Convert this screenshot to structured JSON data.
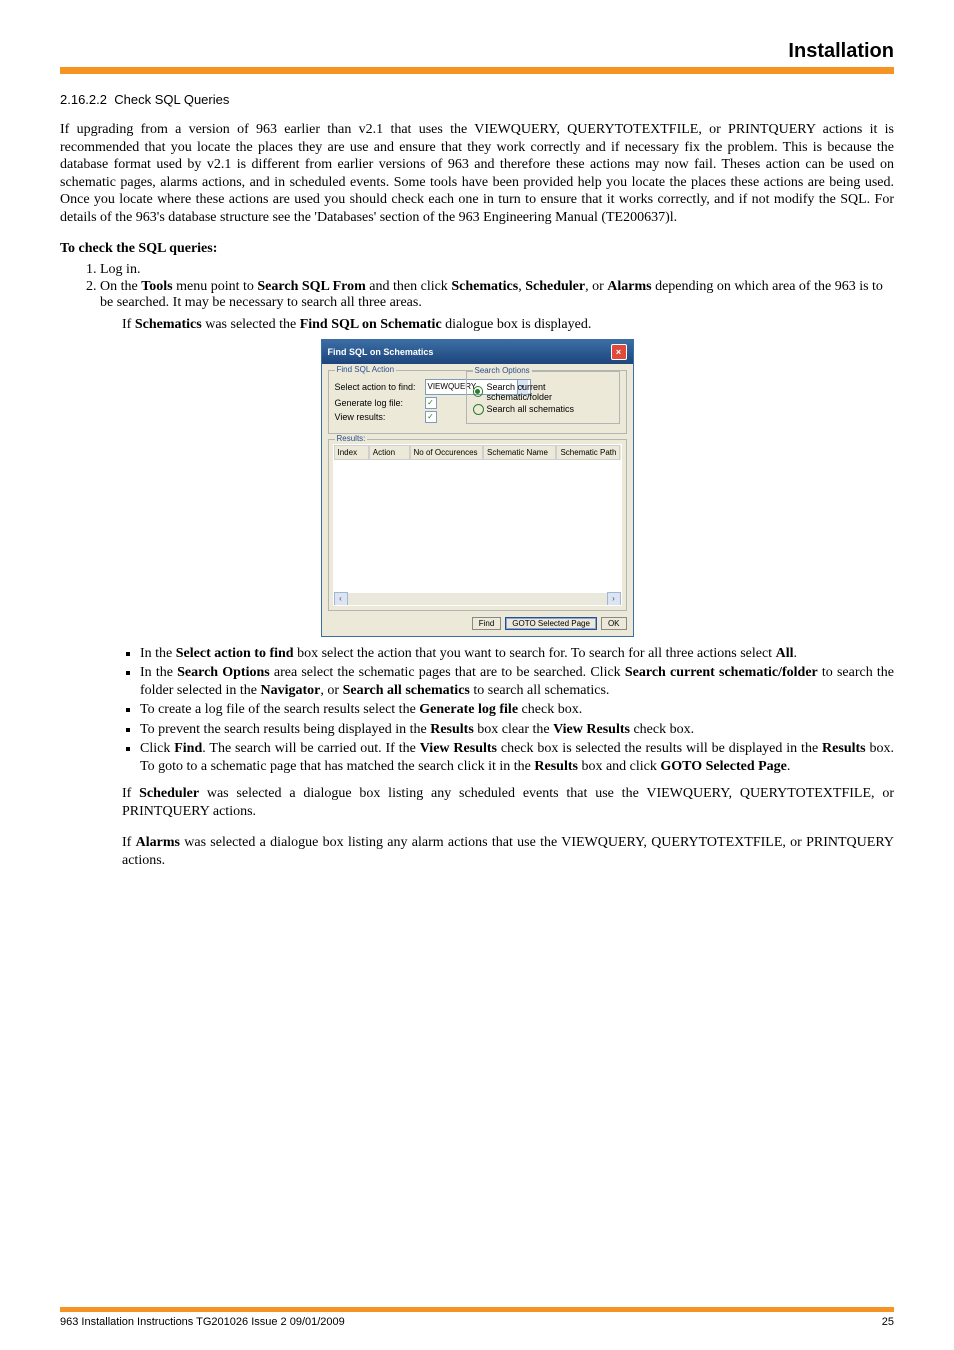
{
  "header": {
    "title": "Installation"
  },
  "section": {
    "number": "2.16.2.2",
    "title": "Check SQL Queries"
  },
  "para1": "If upgrading from a version of 963 earlier than v2.1 that uses the VIEWQUERY, QUERYTOTEXTFILE, or PRINTQUERY actions it is recommended that you locate the places they are use and ensure that they work correctly and if necessary fix the problem. This is because the database format used by v2.1 is different from earlier versions of 963 and therefore these actions may now fail. Theses action can be used on schematic pages, alarms actions, and in scheduled events. Some tools have been provided help you locate the places these actions are being used. Once you locate where these actions are used you should check each one in turn to ensure that it works correctly, and if not modify the SQL. For details of the 963's database structure see the 'Databases' section of the 963 Engineering Manual (TE200637)l.",
  "check_heading": "To check the SQL queries:",
  "steps": {
    "s1": "Log in.",
    "s2_a": "On the ",
    "s2_tools": "Tools",
    "s2_b": " menu point to ",
    "s2_search": "Search SQL From",
    "s2_c": " and then click ",
    "s2_schem": "Schematics",
    "s2_comma1": ", ",
    "s2_sched": "Scheduler",
    "s2_or": ", or ",
    "s2_alarms": "Alarms",
    "s2_d": " depending on which area of the 963 is to be searched. It may be necessary to search all three areas."
  },
  "if_schem_a": "If ",
  "if_schem_b": "Schematics",
  "if_schem_c": " was selected the ",
  "if_schem_d": "Find SQL on Schematic",
  "if_schem_e": " dialogue box is displayed.",
  "dialog": {
    "title": "Find SQL on Schematics",
    "find_action_legend": "Find SQL Action",
    "select_label": "Select action to find:",
    "select_value": "VIEWQUERY",
    "gen_log": "Generate log file:",
    "view_results": "View results:",
    "search_opts_legend": "Search Options",
    "opt_current": "Search current schematic/folder",
    "opt_all": "Search all schematics",
    "results_legend": "Results:",
    "cols": {
      "index": "Index",
      "action": "Action",
      "noocc": "No of Occurences",
      "sname": "Schematic Name",
      "spath": "Schematic Path"
    },
    "btn_find": "Find",
    "btn_goto": "GOTO Selected Page",
    "btn_ok": "OK"
  },
  "bullets": {
    "b1_a": "In the ",
    "b1_b": "Select action to find",
    "b1_c": " box select the action that you want to search for. To search for all three actions select ",
    "b1_d": "All",
    "b1_e": ".",
    "b2_a": "In the ",
    "b2_b": "Search Options",
    "b2_c": " area select the schematic pages that are to be searched. Click ",
    "b2_d": "Search current schematic/folder",
    "b2_e": " to search the folder selected in the ",
    "b2_f": "Navigator",
    "b2_g": ", or ",
    "b2_h": "Search all schematics",
    "b2_i": " to search all schematics.",
    "b3_a": "To create a log file of the search results select the ",
    "b3_b": "Generate log file",
    "b3_c": " check box.",
    "b4_a": "To prevent the search results being displayed in the ",
    "b4_b": "Results",
    "b4_c": " box clear the ",
    "b4_d": "View Results",
    "b4_e": " check box.",
    "b5_a": "Click ",
    "b5_b": "Find",
    "b5_c": ". The search will be carried out. If the ",
    "b5_d": "View Results",
    "b5_e": " check box is selected the results will be displayed in the ",
    "b5_f": "Results",
    "b5_g": " box. To goto to a schematic page that has matched the search click it in the ",
    "b5_h": "Results",
    "b5_i": " box and click ",
    "b5_j": "GOTO Selected Page",
    "b5_k": "."
  },
  "scheduler_para_a": "If ",
  "scheduler_para_b": "Scheduler",
  "scheduler_para_c": " was selected a dialogue box listing any scheduled events that use the VIEWQUERY, QUERYTOTEXTFILE, or PRINTQUERY actions.",
  "alarms_para_a": "If ",
  "alarms_para_b": "Alarms",
  "alarms_para_c": " was selected a dialogue box listing any alarm actions that use the VIEWQUERY, QUERYTOTEXTFILE, or PRINTQUERY actions.",
  "footer": {
    "left": "963 Installation Instructions TG201026 Issue 2 09/01/2009",
    "right": "25"
  }
}
